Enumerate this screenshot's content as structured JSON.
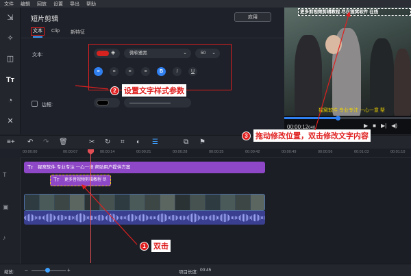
{
  "menu": [
    "文件",
    "编辑",
    "回放",
    "设置",
    "导出",
    "帮助"
  ],
  "editor": {
    "title": "短片剪辑",
    "apply_label": "应用",
    "tabs": [
      "文本",
      "Clip",
      "新特征"
    ],
    "text_label": "文本:",
    "font_name": "微软雅黑",
    "font_size": "50",
    "text_color": "#d6231f",
    "border_label": "边框:",
    "format_buttons": [
      "align-left",
      "align-center",
      "align-right",
      "justify",
      "B",
      "I",
      "U"
    ]
  },
  "preview": {
    "overlay_text": "更多剪视频剪辑教程 尽在猩窝软件 在线",
    "subtitle": "猩窝软件  专业专注 一心一意 帮",
    "timecode": "00:00:12",
    "timecode_frames": "040",
    "progress": 0.42
  },
  "callouts": {
    "c1": {
      "num": "1",
      "text": "双击"
    },
    "c2": {
      "num": "2",
      "text": "设置文字样式参数"
    },
    "c3": {
      "num": "3",
      "text": "拖动修改位置，双击修改文字内容"
    }
  },
  "timeline": {
    "ticks": [
      "00:00:00",
      "00:00:07",
      "00:00:14",
      "00:00:21",
      "00:00:28",
      "00:00:35",
      "00:00:42",
      "00:00:49",
      "00:00:56",
      "00:01:03",
      "00:01:10",
      "00:01:1"
    ],
    "title_clip": "猩窝软件 专业专注 一心一意 帮助用户提供方案",
    "title_clip2": "更多音视频剪辑教程 尽",
    "scale_label": "缩放:",
    "duration_label": "项目长度:",
    "duration_value": "00:45"
  }
}
